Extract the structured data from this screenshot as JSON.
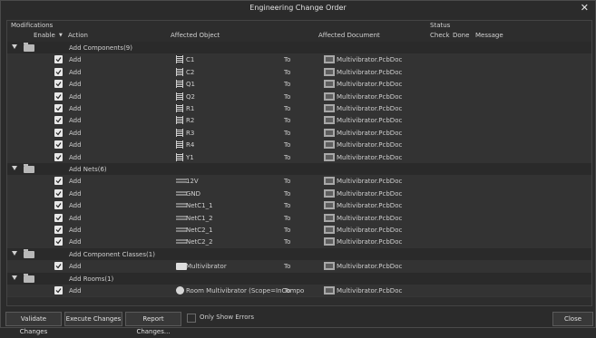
{
  "window": {
    "title": "Engineering Change Order"
  },
  "headers": {
    "group_modifications": "Modifications",
    "group_status": "Status",
    "enable": "Enable",
    "action": "Action",
    "affected_object": "Affected Object",
    "affected_document": "Affected Document",
    "check": "Check",
    "done": "Done",
    "message": "Message"
  },
  "rows": [
    {
      "type": "group",
      "label": "Add Components(9)"
    },
    {
      "type": "item",
      "action": "Add",
      "object": "C1",
      "icon": "component-icon",
      "to": "To",
      "document": "Multivibrator.PcbDoc"
    },
    {
      "type": "item",
      "action": "Add",
      "object": "C2",
      "icon": "component-icon",
      "to": "To",
      "document": "Multivibrator.PcbDoc"
    },
    {
      "type": "item",
      "action": "Add",
      "object": "Q1",
      "icon": "component-icon",
      "to": "To",
      "document": "Multivibrator.PcbDoc"
    },
    {
      "type": "item",
      "action": "Add",
      "object": "Q2",
      "icon": "component-icon",
      "to": "To",
      "document": "Multivibrator.PcbDoc"
    },
    {
      "type": "item",
      "action": "Add",
      "object": "R1",
      "icon": "component-icon",
      "to": "To",
      "document": "Multivibrator.PcbDoc"
    },
    {
      "type": "item",
      "action": "Add",
      "object": "R2",
      "icon": "component-icon",
      "to": "To",
      "document": "Multivibrator.PcbDoc"
    },
    {
      "type": "item",
      "action": "Add",
      "object": "R3",
      "icon": "component-icon",
      "to": "To",
      "document": "Multivibrator.PcbDoc"
    },
    {
      "type": "item",
      "action": "Add",
      "object": "R4",
      "icon": "component-icon",
      "to": "To",
      "document": "Multivibrator.PcbDoc"
    },
    {
      "type": "item",
      "action": "Add",
      "object": "Y1",
      "icon": "component-icon",
      "to": "To",
      "document": "Multivibrator.PcbDoc"
    },
    {
      "type": "group",
      "label": "Add Nets(6)"
    },
    {
      "type": "item",
      "action": "Add",
      "object": "12V",
      "icon": "net-icon",
      "to": "To",
      "document": "Multivibrator.PcbDoc"
    },
    {
      "type": "item",
      "action": "Add",
      "object": "GND",
      "icon": "net-icon",
      "to": "To",
      "document": "Multivibrator.PcbDoc"
    },
    {
      "type": "item",
      "action": "Add",
      "object": "NetC1_1",
      "icon": "net-icon",
      "to": "To",
      "document": "Multivibrator.PcbDoc"
    },
    {
      "type": "item",
      "action": "Add",
      "object": "NetC1_2",
      "icon": "net-icon",
      "to": "To",
      "document": "Multivibrator.PcbDoc"
    },
    {
      "type": "item",
      "action": "Add",
      "object": "NetC2_1",
      "icon": "net-icon",
      "to": "To",
      "document": "Multivibrator.PcbDoc"
    },
    {
      "type": "item",
      "action": "Add",
      "object": "NetC2_2",
      "icon": "net-icon",
      "to": "To",
      "document": "Multivibrator.PcbDoc"
    },
    {
      "type": "group",
      "label": "Add Component Classes(1)"
    },
    {
      "type": "item",
      "action": "Add",
      "object": "Multivibrator",
      "icon": "folder-icon",
      "to": "To",
      "document": "Multivibrator.PcbDoc"
    },
    {
      "type": "group",
      "label": "Add Rooms(1)"
    },
    {
      "type": "item",
      "action": "Add",
      "object": "Room Multivibrator (Scope=InCompo",
      "icon": "room-icon",
      "to": "To",
      "document": "Multivibrator.PcbDoc"
    }
  ],
  "footer": {
    "validate": "Validate Changes",
    "execute": "Execute Changes",
    "report": "Report Changes...",
    "only_errors": "Only Show Errors",
    "close": "Close"
  }
}
